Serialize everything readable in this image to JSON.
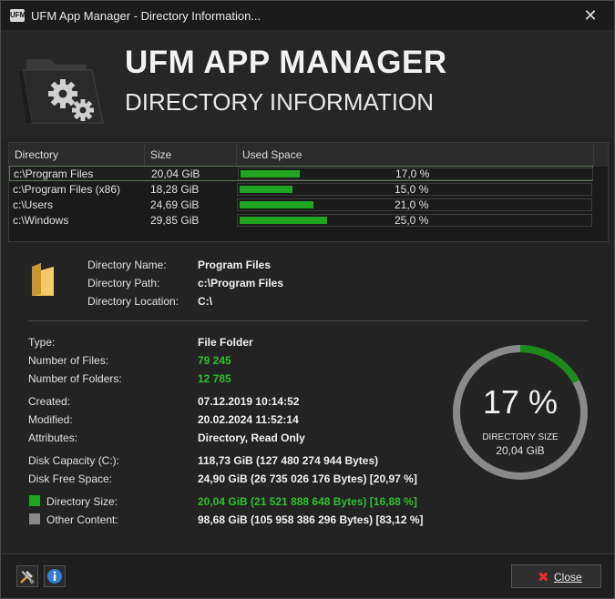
{
  "window": {
    "title": "UFM App Manager - Directory Information...",
    "app_icon": "UFM"
  },
  "header": {
    "title": "UFM APP MANAGER",
    "subtitle": "DIRECTORY INFORMATION"
  },
  "table": {
    "columns": [
      "Directory",
      "Size",
      "Used Space"
    ],
    "rows": [
      {
        "directory": "c:\\Program Files",
        "size": "20,04 GiB",
        "used": 17.0,
        "used_label": "17,0 %"
      },
      {
        "directory": "c:\\Program Files (x86)",
        "size": "18,28 GiB",
        "used": 15.0,
        "used_label": "15,0 %"
      },
      {
        "directory": "c:\\Users",
        "size": "24,69 GiB",
        "used": 21.0,
        "used_label": "21,0 %"
      },
      {
        "directory": "c:\\Windows",
        "size": "29,85 GiB",
        "used": 25.0,
        "used_label": "25,0 %"
      }
    ]
  },
  "info": {
    "directory_name_label": "Directory Name:",
    "directory_name": "Program Files",
    "directory_path_label": "Directory Path:",
    "directory_path": "c:\\Program Files",
    "directory_location_label": "Directory Location:",
    "directory_location": "C:\\",
    "type_label": "Type:",
    "type": "File Folder",
    "files_label": "Number of Files:",
    "files": "79 245",
    "folders_label": "Number of Folders:",
    "folders": "12 785",
    "created_label": "Created:",
    "created": "07.12.2019 10:14:52",
    "modified_label": "Modified:",
    "modified": "20.02.2024 11:52:14",
    "attributes_label": "Attributes:",
    "attributes": "Directory, Read Only",
    "disk_capacity_label": "Disk Capacity (C:):",
    "disk_capacity": "118,73 GiB (127 480 274 944 Bytes)",
    "disk_free_label": "Disk Free Space:",
    "disk_free": "24,90 GiB (26 735 026 176 Bytes) [20,97 %]",
    "dir_size_label": "Directory Size:",
    "dir_size": "20,04 GiB (21 521 888 648 Bytes) [16,88 %]",
    "other_label": "Other Content:",
    "other": "98,68 GiB (105 958 386 296 Bytes) [83,12 %]"
  },
  "gauge": {
    "percent_label": "17 %",
    "percent": 17,
    "caption": "DIRECTORY SIZE",
    "size": "20,04 GiB"
  },
  "colors": {
    "accent": "#1fa51f",
    "green_text": "#2fc02f",
    "other": "#8a8a8a",
    "close_x": "#e23030"
  },
  "footer": {
    "close_label": "Close",
    "tools_icon": "tools-icon",
    "info_icon": "info-icon"
  }
}
